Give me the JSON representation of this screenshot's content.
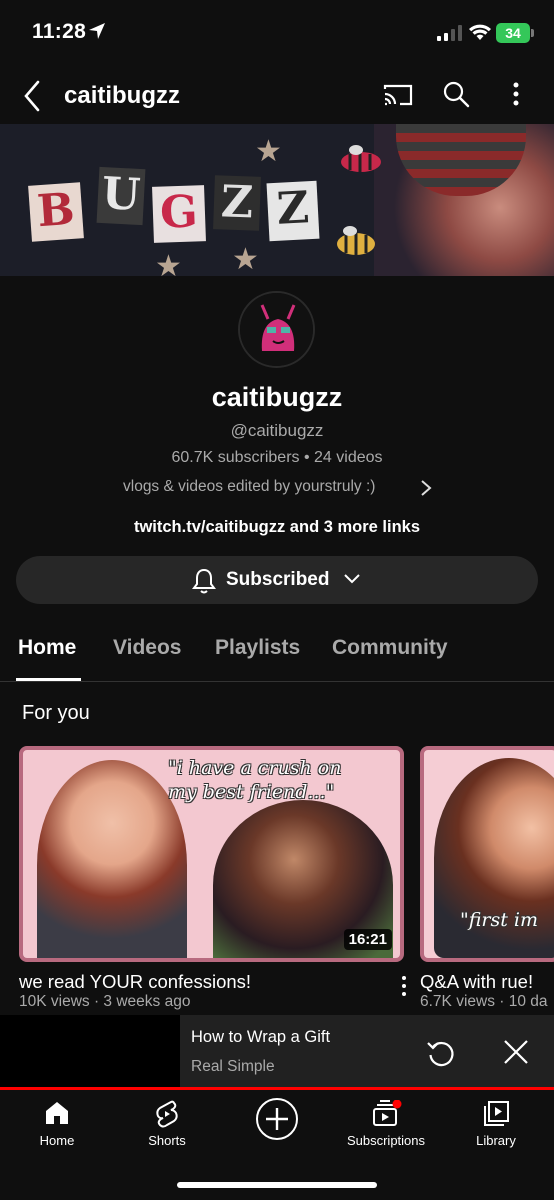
{
  "status_bar": {
    "time": "11:28",
    "battery": "34"
  },
  "header": {
    "channel_title": "caitibugzz"
  },
  "banner": {
    "letters": [
      "B",
      "U",
      "G",
      "Z",
      "Z"
    ]
  },
  "channel": {
    "name": "caitibugzz",
    "handle": "@caitibugzz",
    "stats": "60.7K subscribers • 24 videos",
    "description": "vlogs & videos edited by yourstruly :)",
    "links": "twitch.tv/caitibugzz and 3 more links",
    "subscribe_label": "Subscribed"
  },
  "tabs": [
    {
      "label": "Home",
      "active": true
    },
    {
      "label": "Videos",
      "active": false
    },
    {
      "label": "Playlists",
      "active": false
    },
    {
      "label": "Community",
      "active": false
    }
  ],
  "section": {
    "title": "For you"
  },
  "videos": [
    {
      "title": "we read YOUR confessions!",
      "meta": "10K views · 3 weeks ago",
      "duration": "16:21",
      "overlay_text": "\"i have a crush on my best friend...\""
    },
    {
      "title": "Q&A with rue!",
      "meta": "6.7K views · 10 da",
      "overlay_text": "\"first im"
    }
  ],
  "miniplayer": {
    "title": "How to Wrap a Gift",
    "channel": "Real Simple",
    "progress_fraction": 1.0
  },
  "bottom_nav": [
    {
      "label": "Home",
      "icon": "home-icon"
    },
    {
      "label": "Shorts",
      "icon": "shorts-icon"
    },
    {
      "label": "",
      "icon": "create-icon"
    },
    {
      "label": "Subscriptions",
      "icon": "subscriptions-icon"
    },
    {
      "label": "Library",
      "icon": "library-icon"
    }
  ],
  "colors": {
    "background": "#0f0f0f",
    "accent_red": "#ff0000",
    "battery_green": "#34c759",
    "thumb_border": "#b86a7f"
  }
}
